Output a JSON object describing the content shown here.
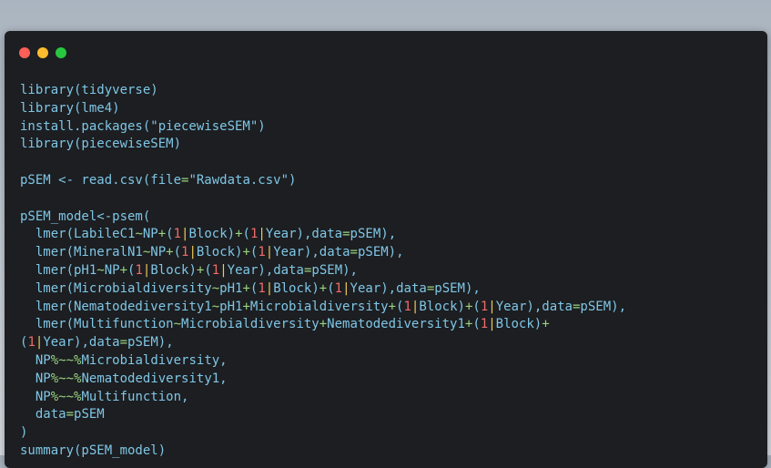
{
  "window": {
    "buttons": [
      "close",
      "minimize",
      "maximize"
    ]
  },
  "code": {
    "lines": [
      "library(tidyverse)",
      "library(lme4)",
      "install.packages(\"piecewiseSEM\")",
      "library(piecewiseSEM)",
      "",
      "pSEM <- read.csv(file=\"Rawdata.csv\")",
      "",
      "pSEM_model<-psem(",
      "  lmer(LabileC1~NP+(1|Block)+(1|Year),data=pSEM),",
      "  lmer(MineralN1~NP+(1|Block)+(1|Year),data=pSEM),",
      "  lmer(pH1~NP+(1|Block)+(1|Year),data=pSEM),",
      "  lmer(Microbialdiversity~pH1+(1|Block)+(1|Year),data=pSEM),",
      "  lmer(Nematodediversity1~pH1+Microbialdiversity+(1|Block)+(1|Year),data=pSEM),",
      "  lmer(Multifunction~Microbialdiversity+Nematodediversity1+(1|Block)+",
      "(1|Year),data=pSEM),",
      "  NP%~~%Microbialdiversity,",
      "  NP%~~%Nematodediversity1,",
      "  NP%~~%Multifunction,",
      "  data=pSEM",
      ")",
      "summary(pSEM_model)"
    ]
  },
  "colors": {
    "keyword": "#7fc6e6",
    "number": "#ef6b6b",
    "pipe": "#f0c95a",
    "operator": "#9ad37f",
    "background": "#1c1e21"
  }
}
